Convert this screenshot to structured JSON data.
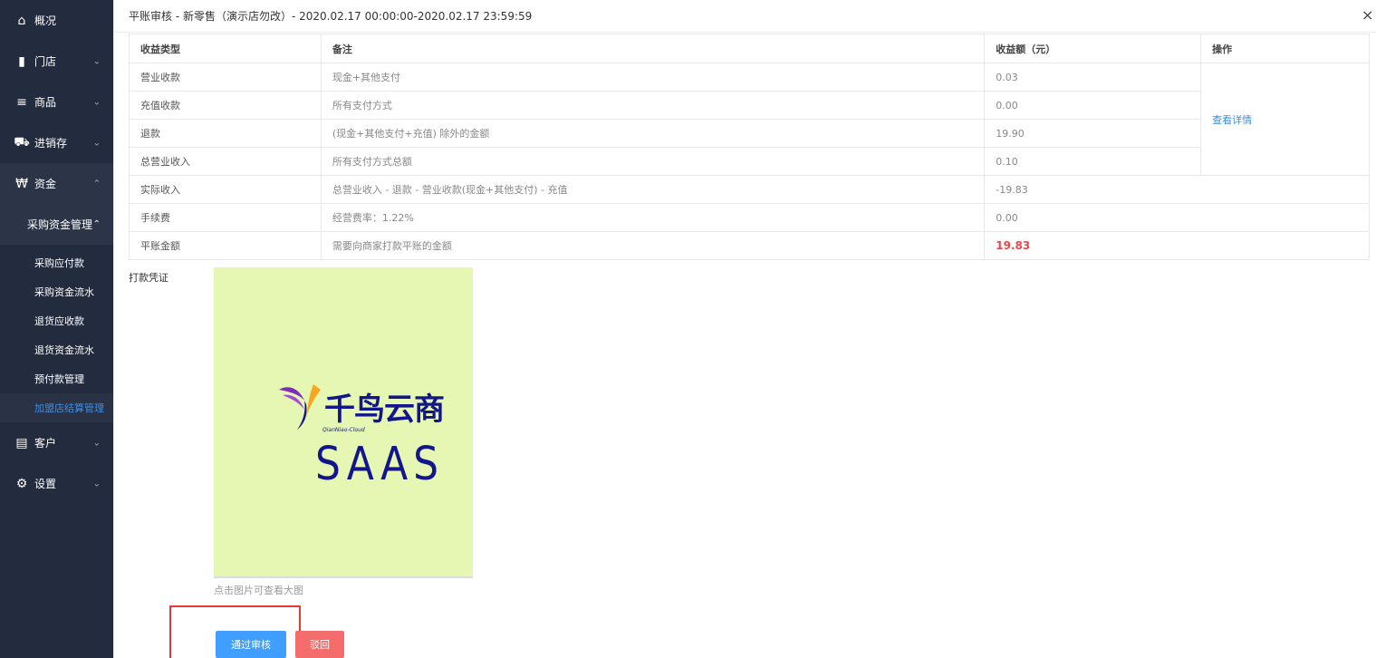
{
  "sidebar": {
    "items": [
      {
        "label": "概况",
        "icon": "home-icon",
        "glyph": "⌂"
      },
      {
        "label": "门店",
        "icon": "store-icon",
        "glyph": "▮"
      },
      {
        "label": "商品",
        "icon": "list-icon",
        "glyph": "≡"
      },
      {
        "label": "进销存",
        "icon": "truck-icon",
        "glyph": "⛟"
      },
      {
        "label": "资金",
        "icon": "won-icon",
        "glyph": "₩"
      }
    ],
    "sub_group": "采购资金管理",
    "sub_items": [
      "采购应付款",
      "采购资金流水",
      "退货应收款",
      "退货资金流水",
      "预付款管理",
      "加盟店结算管理"
    ],
    "bottom_items": [
      {
        "label": "客户",
        "icon": "id-card-icon",
        "glyph": "▤"
      },
      {
        "label": "设置",
        "icon": "gear-icon",
        "glyph": "⚙"
      }
    ]
  },
  "modal": {
    "title": "平账审核 - 新零售（演示店勿改）- 2020.02.17 00:00:00-2020.02.17 23:59:59",
    "close": "×"
  },
  "table": {
    "headers": [
      "收益类型",
      "备注",
      "收益额（元）",
      "操作"
    ],
    "rows": [
      {
        "type": "营业收款",
        "note": "现金+其他支付",
        "amount": "0.03"
      },
      {
        "type": "充值收款",
        "note": "所有支付方式",
        "amount": "0.00"
      },
      {
        "type": "退款",
        "note": "(现金+其他支付+充值) 除外的金额",
        "amount": "19.90"
      },
      {
        "type": "总营业收入",
        "note": "所有支付方式总额",
        "amount": "0.10"
      },
      {
        "type": "实际收入",
        "note": "总营业收入 - 退款 - 营业收款(现金+其他支付) - 充值",
        "amount": "-19.83"
      },
      {
        "type": "手续费",
        "note": "经营费率：1.22%",
        "amount": "0.00"
      },
      {
        "type": "平账金额",
        "note": "需要向商家打款平账的金额",
        "amount": "19.83"
      }
    ],
    "action_link": "查看详情"
  },
  "voucher": {
    "label": "打款凭证",
    "logo_title": "千鸟云商",
    "logo_sub": "QianNiao-Cloud",
    "logo_saas": "SAAS",
    "hint": "点击图片可查看大图"
  },
  "buttons": {
    "approve": "通过审核",
    "reject": "驳回"
  },
  "colors": {
    "sidebar_bg": "#232b3f",
    "accent": "#409eff",
    "danger": "#f56c6c",
    "highlight": "#e53935"
  }
}
